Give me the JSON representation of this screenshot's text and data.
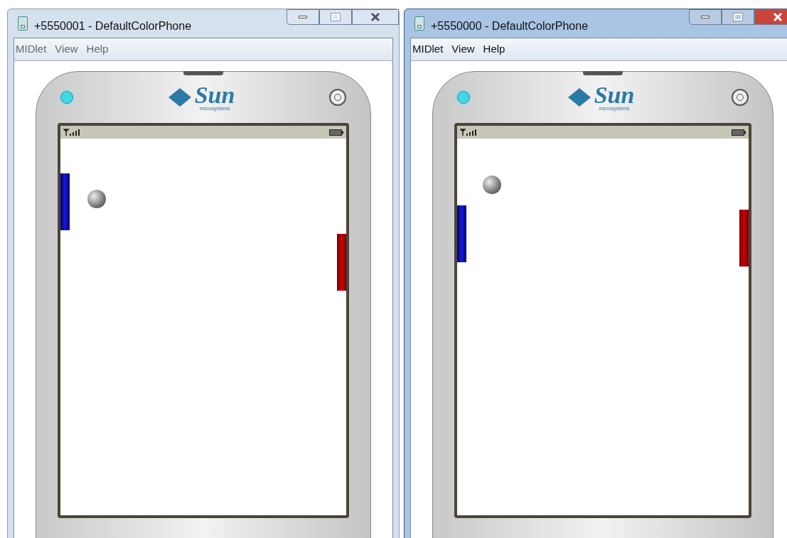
{
  "windows": [
    {
      "title": "+5550001 - DefaultColorPhone",
      "active": false,
      "menu": [
        "MIDlet",
        "View",
        "Help"
      ],
      "logo": {
        "name": "Sun",
        "tagline": "microsystems"
      }
    },
    {
      "title": "+5550000 - DefaultColorPhone",
      "active": true,
      "menu": [
        "MIDlet",
        "View",
        "Help"
      ],
      "logo": {
        "name": "Sun",
        "tagline": "microsystems"
      }
    }
  ]
}
